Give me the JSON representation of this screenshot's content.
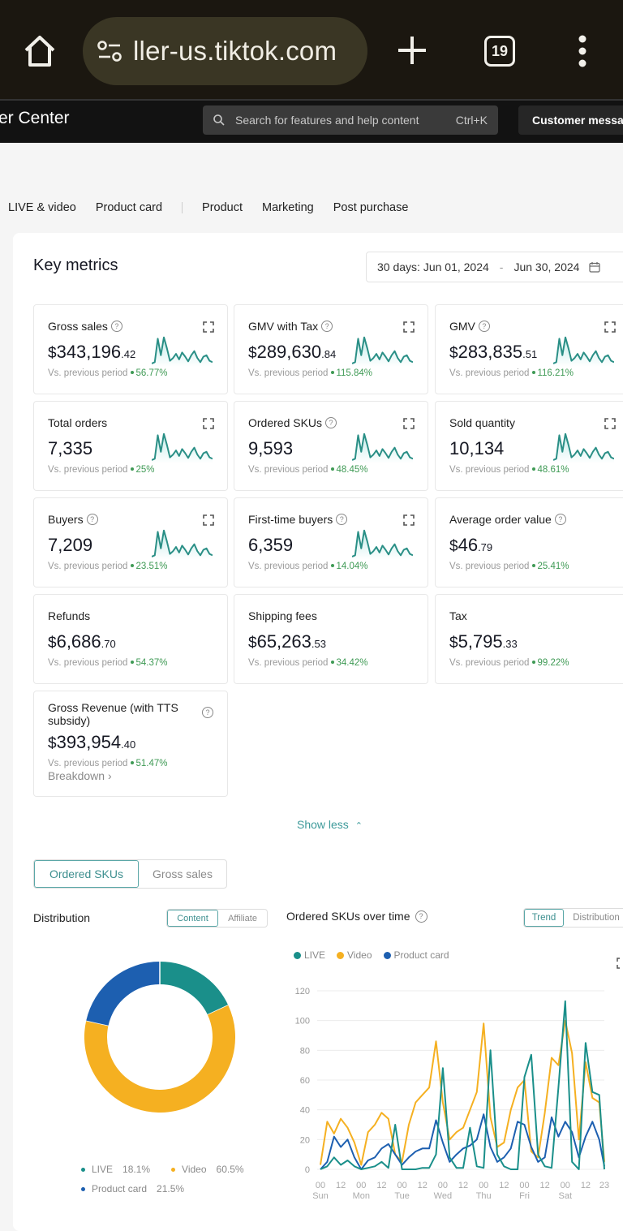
{
  "browser": {
    "url": "ller-us.tiktok.com",
    "tab_count": "19",
    "icons": [
      "home-icon",
      "site-settings-icon",
      "new-tab-plus-icon",
      "tab-switcher-icon",
      "more-vert-icon"
    ]
  },
  "header": {
    "app_title": "er Center",
    "search_placeholder": "Search for features and help content",
    "search_shortcut": "Ctrl+K",
    "customer_button": "Customer messa"
  },
  "nav": {
    "tabs": [
      "LIVE & video",
      "Product card",
      "Product",
      "Marketing",
      "Post purchase"
    ]
  },
  "key_metrics": {
    "title": "Key metrics",
    "date_range": {
      "label": "30 days:",
      "start": "Jun 01, 2024",
      "separator": "-",
      "end": "Jun 30, 2024"
    },
    "compare_label": "Vs. previous period",
    "cards": [
      {
        "title": "Gross sales",
        "help": true,
        "currency": "$",
        "value": "343,196",
        "decimals": ".42",
        "change": "56.77%",
        "trend": "up",
        "sparkline": true
      },
      {
        "title": "GMV with Tax",
        "help": true,
        "currency": "$",
        "value": "289,630",
        "decimals": ".84",
        "change": "115.84%",
        "trend": "up",
        "sparkline": true
      },
      {
        "title": "GMV",
        "help": true,
        "currency": "$",
        "value": "283,835",
        "decimals": ".51",
        "change": "116.21%",
        "trend": "up",
        "sparkline": true
      },
      {
        "title": "Total orders",
        "help": false,
        "currency": "",
        "value": "7,335",
        "decimals": "",
        "change": "25%",
        "trend": "up",
        "sparkline": true
      },
      {
        "title": "Ordered SKUs",
        "help": true,
        "currency": "",
        "value": "9,593",
        "decimals": "",
        "change": "48.45%",
        "trend": "up",
        "sparkline": true
      },
      {
        "title": "Sold quantity",
        "help": false,
        "currency": "",
        "value": "10,134",
        "decimals": "",
        "change": "48.61%",
        "trend": "up",
        "sparkline": true
      },
      {
        "title": "Buyers",
        "help": true,
        "currency": "",
        "value": "7,209",
        "decimals": "",
        "change": "23.51%",
        "trend": "up",
        "sparkline": true
      },
      {
        "title": "First-time buyers",
        "help": true,
        "currency": "",
        "value": "6,359",
        "decimals": "",
        "change": "14.04%",
        "trend": "up",
        "sparkline": true
      },
      {
        "title": "Average order value",
        "help": true,
        "currency": "$",
        "value": "46",
        "decimals": ".79",
        "change": "25.41%",
        "trend": "up",
        "sparkline": false
      },
      {
        "title": "Refunds",
        "help": false,
        "currency": "$",
        "value": "6,686",
        "decimals": ".70",
        "change": "54.37%",
        "trend": "up",
        "sparkline": false
      },
      {
        "title": "Shipping fees",
        "help": false,
        "currency": "$",
        "value": "65,263",
        "decimals": ".53",
        "change": "34.42%",
        "trend": "up",
        "sparkline": false
      },
      {
        "title": "Tax",
        "help": false,
        "currency": "$",
        "value": "5,795",
        "decimals": ".33",
        "change": "99.22%",
        "trend": "up",
        "sparkline": false
      },
      {
        "title": "Gross Revenue (with TTS subsidy)",
        "help": true,
        "currency": "$",
        "value": "393,954",
        "decimals": ".40",
        "change": "51.47%",
        "trend": "up",
        "sparkline": false,
        "link": "Breakdown"
      }
    ],
    "show_less": "Show less"
  },
  "metric_toggle": {
    "options": [
      "Ordered SKUs",
      "Gross sales"
    ],
    "selected": "Ordered SKUs"
  },
  "distribution": {
    "title": "Distribution",
    "toggle": {
      "options": [
        "Content",
        "Affiliate"
      ],
      "selected": "Content"
    }
  },
  "trend": {
    "title": "Ordered SKUs over time",
    "toggle": {
      "options": [
        "Trend",
        "Distribution"
      ],
      "selected": "Trend"
    }
  },
  "colors": {
    "accent": "#3d9a9a",
    "positive": "#3f9a55",
    "live": "#1a8f8a",
    "video": "#f5b021",
    "product_card": "#1d5fb0",
    "sparkline": "#2a8f86"
  },
  "chart_data": [
    {
      "type": "pie",
      "title": "Distribution",
      "variant": "donut",
      "categories": [
        "LIVE",
        "Video",
        "Product card"
      ],
      "values": [
        18.1,
        60.5,
        21.5
      ],
      "labels": [
        "18.1%",
        "60.5%",
        "21.5%"
      ],
      "legend": "bottom"
    },
    {
      "type": "line",
      "title": "Ordered SKUs over time",
      "legend": "top-left",
      "grid": true,
      "ylim": [
        0,
        120
      ],
      "yticks": [
        "0",
        "20",
        "40",
        "60",
        "80",
        "100",
        "120"
      ],
      "xticks": [
        {
          "hour": "00",
          "day": "Sun"
        },
        {
          "hour": "12",
          "day": ""
        },
        {
          "hour": "00",
          "day": "Mon"
        },
        {
          "hour": "12",
          "day": ""
        },
        {
          "hour": "00",
          "day": "Tue"
        },
        {
          "hour": "12",
          "day": ""
        },
        {
          "hour": "00",
          "day": "Wed"
        },
        {
          "hour": "12",
          "day": ""
        },
        {
          "hour": "00",
          "day": "Thu"
        },
        {
          "hour": "12",
          "day": ""
        },
        {
          "hour": "00",
          "day": "Fri"
        },
        {
          "hour": "12",
          "day": ""
        },
        {
          "hour": "00",
          "day": "Sat"
        },
        {
          "hour": "12",
          "day": ""
        },
        {
          "hour": "23",
          "day": ""
        }
      ],
      "x_unit": "hour index (0-167), 4-hour samples",
      "x": [
        0,
        4,
        8,
        12,
        16,
        20,
        24,
        28,
        32,
        36,
        40,
        44,
        48,
        52,
        56,
        60,
        64,
        68,
        72,
        76,
        80,
        84,
        88,
        92,
        96,
        100,
        104,
        108,
        112,
        116,
        120,
        124,
        128,
        132,
        136,
        140,
        144,
        148,
        152,
        156,
        160,
        164,
        167
      ],
      "series": [
        {
          "name": "LIVE",
          "values": [
            0,
            2,
            8,
            3,
            6,
            2,
            0,
            1,
            2,
            5,
            1,
            30,
            0,
            0,
            0,
            1,
            1,
            10,
            68,
            8,
            1,
            1,
            28,
            2,
            1,
            80,
            10,
            2,
            0,
            0,
            62,
            77,
            10,
            2,
            1,
            55,
            113,
            5,
            0,
            85,
            52,
            50,
            0
          ]
        },
        {
          "name": "Video",
          "values": [
            3,
            32,
            24,
            34,
            28,
            18,
            3,
            25,
            30,
            38,
            34,
            10,
            5,
            30,
            45,
            50,
            55,
            86,
            45,
            20,
            25,
            28,
            40,
            52,
            98,
            35,
            15,
            18,
            40,
            55,
            60,
            12,
            8,
            38,
            75,
            70,
            100,
            78,
            20,
            72,
            48,
            45,
            5
          ]
        },
        {
          "name": "Product card",
          "values": [
            0,
            5,
            22,
            15,
            20,
            8,
            0,
            6,
            8,
            14,
            17,
            10,
            3,
            8,
            12,
            14,
            14,
            33,
            18,
            5,
            10,
            14,
            16,
            20,
            37,
            15,
            5,
            8,
            14,
            32,
            30,
            15,
            5,
            8,
            35,
            22,
            32,
            25,
            8,
            22,
            32,
            20,
            2
          ]
        }
      ]
    }
  ]
}
